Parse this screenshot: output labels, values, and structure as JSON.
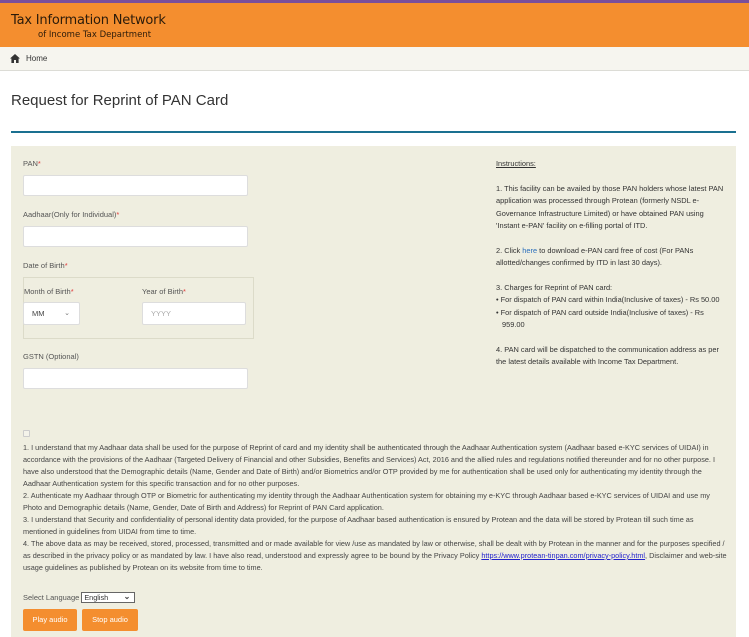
{
  "header": {
    "title_line1": "Tax Information Network",
    "title_line2": "of Income Tax Department"
  },
  "breadcrumb": {
    "home_icon": "home-icon",
    "home_label": "Home"
  },
  "page": {
    "title": "Request for Reprint of PAN Card"
  },
  "form": {
    "pan": {
      "label": "PAN",
      "required_mark": "*",
      "value": "",
      "placeholder": ""
    },
    "aadhaar": {
      "label": "Aadhaar(Only for Individual)",
      "required_mark": "*",
      "value": "",
      "placeholder": ""
    },
    "dob": {
      "label": "Date of Birth",
      "required_mark": "*",
      "month": {
        "label": "Month of Birth",
        "required_mark": "*",
        "selected": "MM",
        "chevron_icon": "chevron-down-icon"
      },
      "year": {
        "label": "Year of Birth",
        "required_mark": "*",
        "value": "",
        "placeholder": "YYYY"
      }
    },
    "gstn": {
      "label": "GSTN (Optional)",
      "value": "",
      "placeholder": ""
    }
  },
  "instructions": {
    "heading": "Instructions:",
    "item1": "1. This facility can be availed by those PAN holders whose latest PAN application was processed through Protean (formerly NSDL e-Governance Infrastructure Limited) or have obtained PAN using 'Instant e-PAN' facility on e-filling portal of ITD.",
    "item2_prefix": "2. Click ",
    "item2_link": "here",
    "item2_suffix": " to download e-PAN card free of cost (For PANs allotted/changes confirmed by ITD in last 30 days).",
    "item3_heading": "3. Charges for Reprint of PAN card:",
    "item3_bullet1": "• For dispatch of PAN card within India(Inclusive of taxes) - Rs 50.00",
    "item3_bullet2": "• For dispatch of PAN card outside India(Inclusive of taxes) - Rs 959.00",
    "item4": "4. PAN card will be dispatched to the communication address as per the latest details available with Income Tax Department."
  },
  "consent": {
    "checked": false,
    "para1": "1. I understand that my Aadhaar data shall be used for the purpose of Reprint of card and my identity shall be authenticated through the Aadhaar Authentication system (Aadhaar based e-KYC services of UIDAI) in accordance with the provisions of the Aadhaar (Targeted Delivery of Financial and other Subsidies, Benefits and Services) Act, 2016 and the allied rules and regulations notified thereunder and for no other purpose. I have also understood that the Demographic details (Name, Gender and Date of Birth) and/or Biometrics and/or OTP provided by me for authentication shall be used only for authenticating my identity through the Aadhaar Authentication system for this specific transaction and for no other purposes.",
    "para2": "2. Authenticate my Aadhaar through OTP or Biometric for authenticating my identity through the Aadhaar Authentication system for obtaining my e-KYC through Aadhaar based e-KYC services of UIDAI and use my Photo and Demographic details (Name, Gender, Date of Birth and Address) for Reprint of PAN Card application.",
    "para3": "3. I understand that Security and confidentiality of personal identity data provided, for the purpose of Aadhaar based authentication is ensured by Protean and the data will be stored by Protean till such time as mentioned in guidelines from UIDAI from time to time.",
    "para4_prefix": "4. The above data as may be received, stored, processed, transmitted and or made available for view /use as mandated by law or otherwise, shall be dealt with by Protean in the manner and for the purposes specified / as described in the privacy policy or as mandated by law. I have also read, understood and expressly agree to be bound by the Privacy Policy ",
    "para4_link": "https://www.protean-tinpan.com/privacy-policy.html",
    "para4_suffix": ", Disclaimer and web-site usage guidelines as published by Protean on its website from time to time."
  },
  "audio": {
    "language_label": "Select Language",
    "language_selected": "English",
    "play_label": "Play audio",
    "stop_label": "Stop audio"
  },
  "colors": {
    "header_orange": "#f48e2f",
    "accent_teal": "#1a7090",
    "panel_bg": "#efeee0",
    "top_strip": "#7a4f9b"
  }
}
